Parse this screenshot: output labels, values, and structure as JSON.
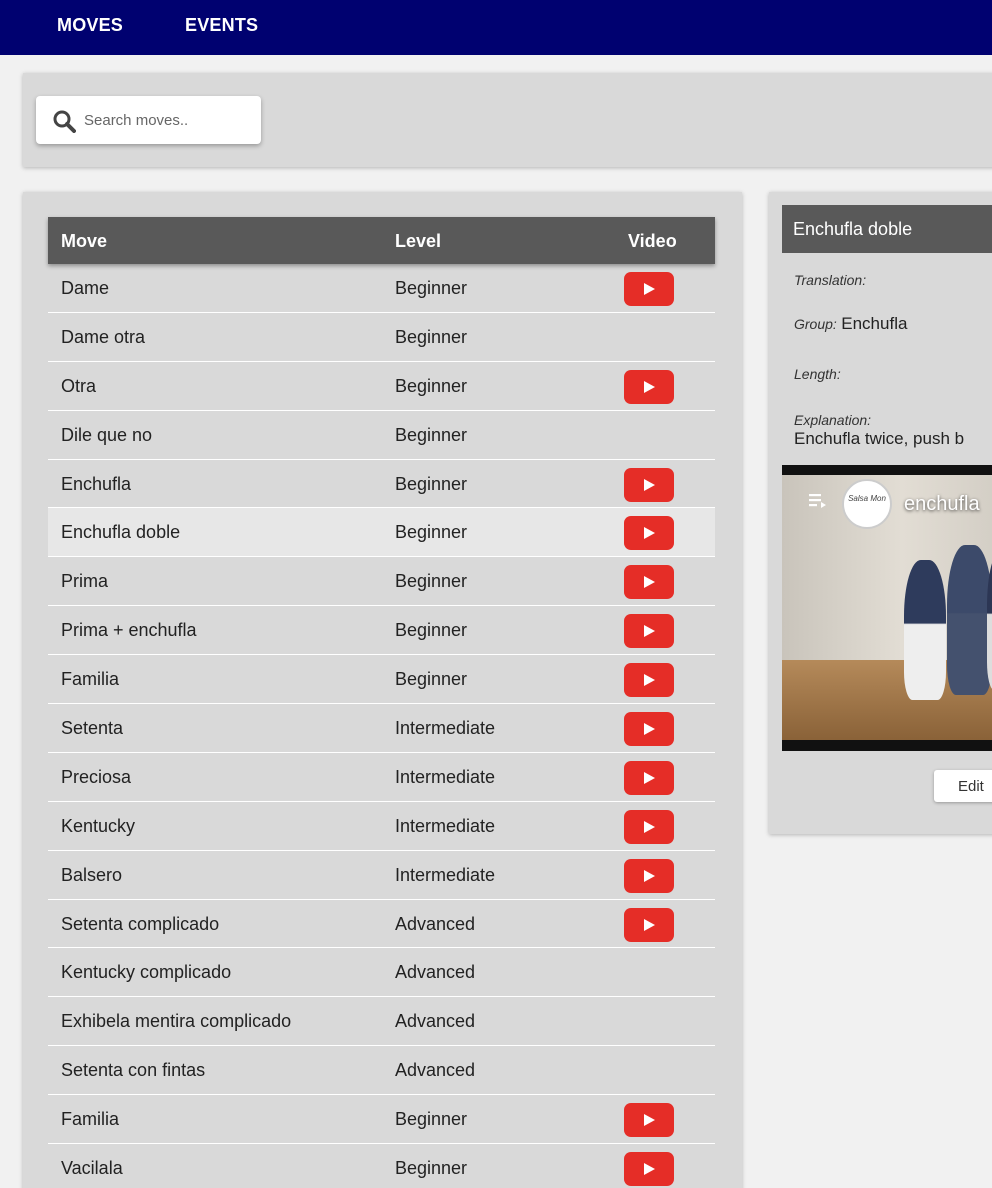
{
  "nav": {
    "moves": "MOVES",
    "events": "EVENTS"
  },
  "search": {
    "placeholder": "Search moves..",
    "value": "",
    "icon": "search-icon"
  },
  "table": {
    "headers": {
      "move": "Move",
      "level": "Level",
      "video": "Video"
    },
    "rows": [
      {
        "move": "Dame",
        "level": "Beginner",
        "video": true
      },
      {
        "move": "Dame otra",
        "level": "Beginner",
        "video": false
      },
      {
        "move": "Otra",
        "level": "Beginner",
        "video": true
      },
      {
        "move": "Dile que no",
        "level": "Beginner",
        "video": false
      },
      {
        "move": "Enchufla",
        "level": "Beginner",
        "video": true
      },
      {
        "move": "Enchufla doble",
        "level": "Beginner",
        "video": true,
        "selected": true
      },
      {
        "move": "Prima",
        "level": "Beginner",
        "video": true
      },
      {
        "move": "Prima + enchufla",
        "level": "Beginner",
        "video": true
      },
      {
        "move": "Familia",
        "level": "Beginner",
        "video": true
      },
      {
        "move": "Setenta",
        "level": "Intermediate",
        "video": true
      },
      {
        "move": "Preciosa",
        "level": "Intermediate",
        "video": true
      },
      {
        "move": "Kentucky",
        "level": "Intermediate",
        "video": true
      },
      {
        "move": "Balsero",
        "level": "Intermediate",
        "video": true
      },
      {
        "move": "Setenta complicado",
        "level": "Advanced",
        "video": true
      },
      {
        "move": "Kentucky complicado",
        "level": "Advanced",
        "video": false
      },
      {
        "move": "Exhibela mentira complicado",
        "level": "Advanced",
        "video": false
      },
      {
        "move": "Setenta con fintas",
        "level": "Advanced",
        "video": false
      },
      {
        "move": "Familia",
        "level": "Beginner",
        "video": true
      },
      {
        "move": "Vacilala",
        "level": "Beginner",
        "video": true
      }
    ]
  },
  "detail": {
    "title": "Enchufla doble",
    "translation_label": "Translation:",
    "translation_value": "",
    "group_label": "Group:",
    "group_value": "Enchufla",
    "length_label": "Length:",
    "length_value": "",
    "explanation_label": "Explanation:",
    "explanation_value": "Enchufla twice, push b",
    "video": {
      "title": "enchufla",
      "channel": "Salsa Mon"
    },
    "edit_label": "Edit"
  },
  "colors": {
    "navbar": "#000170",
    "header": "#595959",
    "youtube": "#e52d27",
    "panel": "#d9d9d9"
  }
}
